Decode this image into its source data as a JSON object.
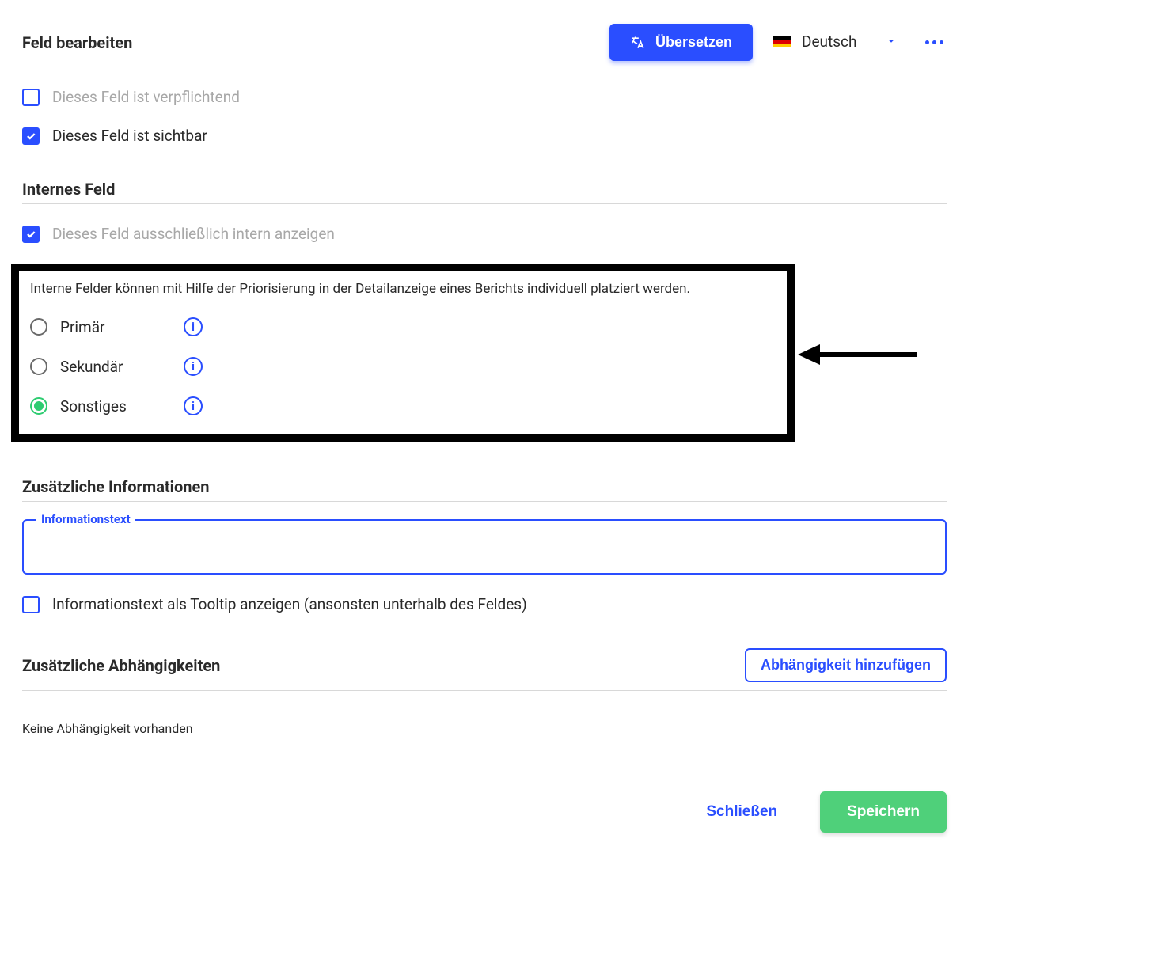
{
  "header": {
    "title": "Feld bearbeiten",
    "translate_label": "Übersetzen",
    "language": "Deutsch"
  },
  "checks": {
    "mandatory": "Dieses Feld ist verpflichtend",
    "visible": "Dieses Feld ist sichtbar"
  },
  "internal": {
    "heading": "Internes Feld",
    "only_internal": "Dieses Feld ausschließlich intern anzeigen",
    "note": "Interne Felder können mit Hilfe der Priorisierung in der Detailanzeige eines Berichts individuell platziert werden.",
    "options": [
      {
        "label": "Primär"
      },
      {
        "label": "Sekundär"
      },
      {
        "label": "Sonstiges"
      }
    ]
  },
  "additional_info": {
    "heading": "Zusätzliche Informationen",
    "field_label": "Informationstext",
    "field_value": "",
    "tooltip_check": "Informationstext als Tooltip anzeigen (ansonsten unterhalb des Feldes)"
  },
  "dependencies": {
    "heading": "Zusätzliche Abhängigkeiten",
    "add_button": "Abhängigkeit hinzufügen",
    "empty": "Keine Abhängigkeit vorhanden"
  },
  "footer": {
    "close": "Schließen",
    "save": "Speichern"
  }
}
